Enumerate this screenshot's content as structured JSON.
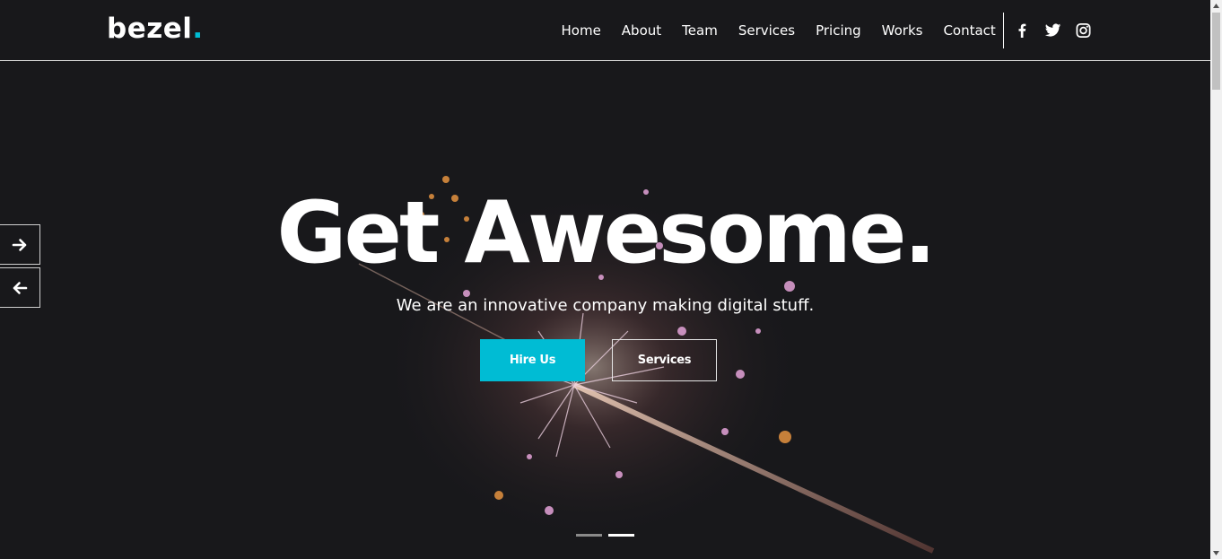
{
  "brand": {
    "name": "bezel",
    "dot": ".",
    "accent": "#00bcd4"
  },
  "nav": {
    "items": [
      {
        "label": "Home"
      },
      {
        "label": "About"
      },
      {
        "label": "Team"
      },
      {
        "label": "Services"
      },
      {
        "label": "Pricing"
      },
      {
        "label": "Works"
      },
      {
        "label": "Contact"
      }
    ]
  },
  "social": [
    "facebook-icon",
    "twitter-icon",
    "instagram-icon"
  ],
  "hero": {
    "headline": "Get Awesome.",
    "subheadline": "We are an innovative company making digital stuff.",
    "primary_button": "Hire Us",
    "secondary_button": "Services",
    "slides_total": 2,
    "active_slide": 2
  },
  "slider_controls": {
    "next_icon": "arrow-right-icon",
    "prev_icon": "arrow-left-icon"
  }
}
